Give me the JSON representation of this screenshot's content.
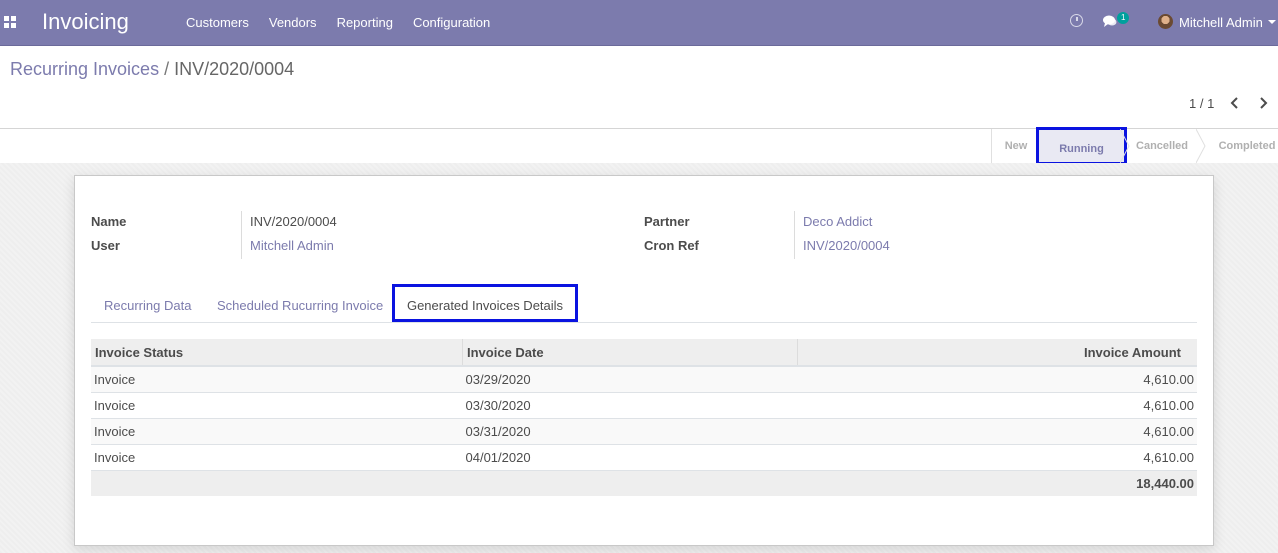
{
  "navbar": {
    "app_name": "Invoicing",
    "menu": [
      "Customers",
      "Vendors",
      "Reporting",
      "Configuration"
    ],
    "chat_badge": "1",
    "user_name": "Mitchell Admin",
    "color": "#7c7bad"
  },
  "breadcrumb": {
    "parent": "Recurring Invoices",
    "separator": "/",
    "current": "INV/2020/0004"
  },
  "pager": {
    "value": "1 / 1"
  },
  "statusbar": {
    "stages": [
      "New",
      "Running",
      "Cancelled",
      "Completed"
    ],
    "active": "Running"
  },
  "form": {
    "name_label": "Name",
    "name_value": "INV/2020/0004",
    "user_label": "User",
    "user_value": "Mitchell Admin",
    "partner_label": "Partner",
    "partner_value": "Deco Addict",
    "cron_label": "Cron Ref",
    "cron_value": "INV/2020/0004"
  },
  "tabs": [
    "Recurring Data",
    "Scheduled Rucurring Invoice",
    "Generated Invoices Details"
  ],
  "active_tab": "Generated Invoices Details",
  "table": {
    "headers": [
      "Invoice Status",
      "Invoice Date",
      "Invoice Amount"
    ],
    "rows": [
      [
        "Invoice",
        "03/29/2020",
        "4,610.00"
      ],
      [
        "Invoice",
        "03/30/2020",
        "4,610.00"
      ],
      [
        "Invoice",
        "03/31/2020",
        "4,610.00"
      ],
      [
        "Invoice",
        "04/01/2020",
        "4,610.00"
      ]
    ],
    "total": "18,440.00"
  },
  "highlight_color": "#0a13e0"
}
